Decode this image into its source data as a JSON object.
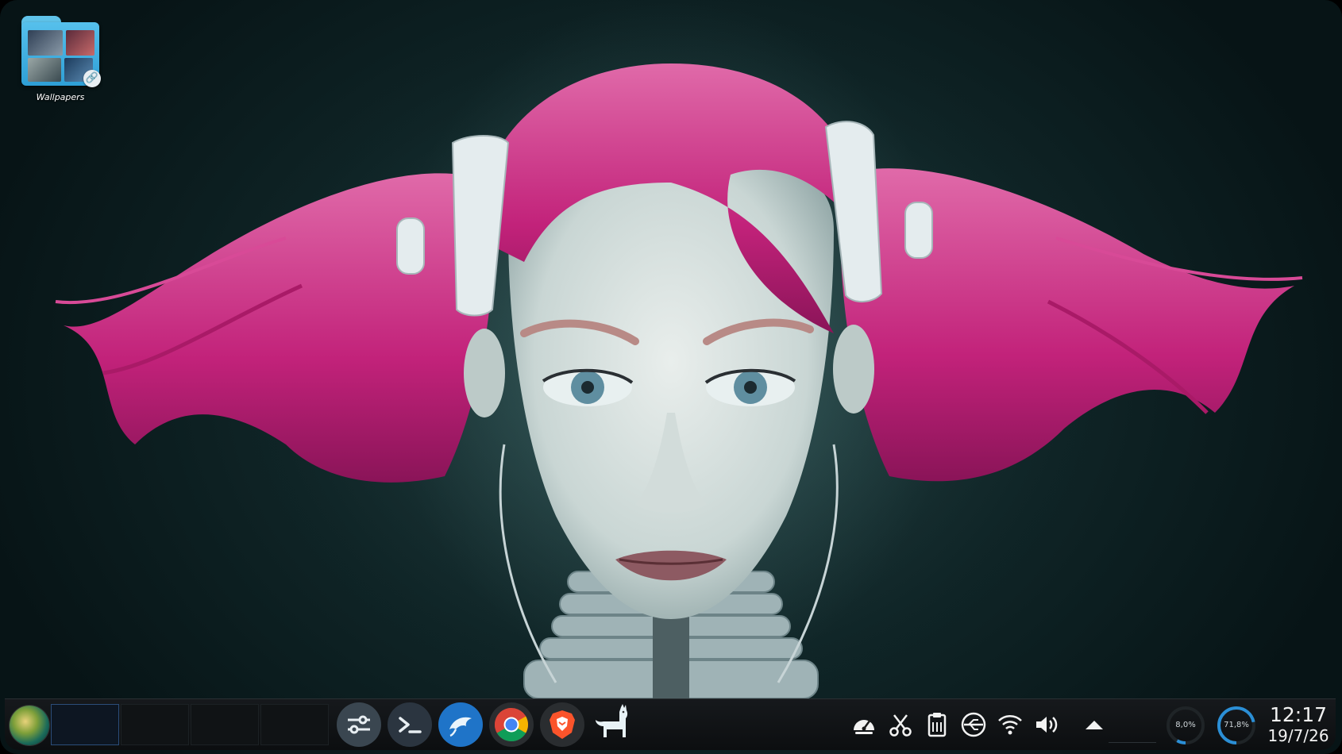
{
  "desktop": {
    "icons": [
      {
        "label": "Wallpapers",
        "icon": "folder-link-icon"
      }
    ]
  },
  "taskbar": {
    "launcher": {
      "icon": "application-launcher-icon"
    },
    "pager": {
      "desktops": 4,
      "active_index": 0
    },
    "tasks": [
      {
        "name": "system-settings",
        "icon": "sliders-icon"
      },
      {
        "name": "konsole",
        "icon": "terminal-icon"
      },
      {
        "name": "dolphin",
        "icon": "dolphin-icon"
      },
      {
        "name": "google-chrome",
        "icon": "chrome-icon"
      },
      {
        "name": "brave",
        "icon": "brave-lion-icon"
      },
      {
        "name": "alpaca",
        "icon": "llama-icon"
      }
    ],
    "tray": [
      {
        "name": "speedometer",
        "icon": "speedometer-icon"
      },
      {
        "name": "screenshot",
        "icon": "scissors-icon"
      },
      {
        "name": "clipboard",
        "icon": "clipboard-icon"
      },
      {
        "name": "usb",
        "icon": "usb-icon"
      },
      {
        "name": "network",
        "icon": "wifi-icon"
      },
      {
        "name": "volume",
        "icon": "speaker-icon"
      },
      {
        "name": "expand",
        "icon": "chevron-up-icon"
      }
    ],
    "monitors": {
      "cpu": {
        "label": "8,0%",
        "fraction": 0.08
      },
      "memory": {
        "label": "71,8%",
        "fraction": 0.718
      }
    },
    "clock": {
      "time": "12:17",
      "date": "19/7/26"
    }
  },
  "colors": {
    "accent": "#2b8fd6",
    "hair": "#c4267e",
    "panel": "#121517"
  }
}
